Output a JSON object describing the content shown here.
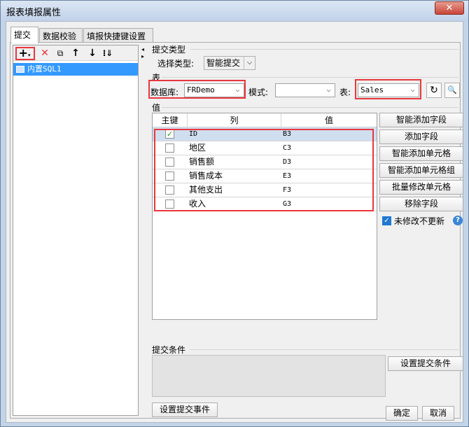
{
  "window": {
    "title": "报表填报属性",
    "close_label": "✕"
  },
  "tabs": [
    {
      "label": "提交"
    },
    {
      "label": "数据校验"
    },
    {
      "label": "填报快捷键设置"
    }
  ],
  "left": {
    "items": [
      {
        "label": "内置SQL1"
      }
    ]
  },
  "submit_type": {
    "section_label": "提交类型",
    "select_label": "选择类型:",
    "value": "智能提交"
  },
  "table": {
    "section_label": "表",
    "db_label": "数据库:",
    "db_value": "FRDemo",
    "schema_label": "模式:",
    "schema_value": "",
    "table_label": "表:",
    "table_value": "Sales"
  },
  "values": {
    "section_label": "值",
    "headers": [
      "主键",
      "列",
      "值"
    ],
    "rows": [
      {
        "key": true,
        "column": "ID",
        "value": "B3"
      },
      {
        "key": false,
        "column": "地区",
        "value": "C3"
      },
      {
        "key": false,
        "column": "销售额",
        "value": "D3"
      },
      {
        "key": false,
        "column": "销售成本",
        "value": "E3"
      },
      {
        "key": false,
        "column": "其他支出",
        "value": "F3"
      },
      {
        "key": false,
        "column": "收入",
        "value": "G3"
      }
    ]
  },
  "side_buttons": [
    "智能添加字段",
    "添加字段",
    "智能添加单元格",
    "智能添加单元格组",
    "批量修改单元格",
    "移除字段"
  ],
  "no_update": {
    "label": "未修改不更新",
    "checked": true
  },
  "condition": {
    "section_label": "提交条件",
    "button_label": "设置提交条件"
  },
  "event_button": "设置提交事件",
  "footer": {
    "ok": "确定",
    "cancel": "取消"
  },
  "colors": {
    "highlight": "#e8373e",
    "selection": "#3399ff"
  }
}
